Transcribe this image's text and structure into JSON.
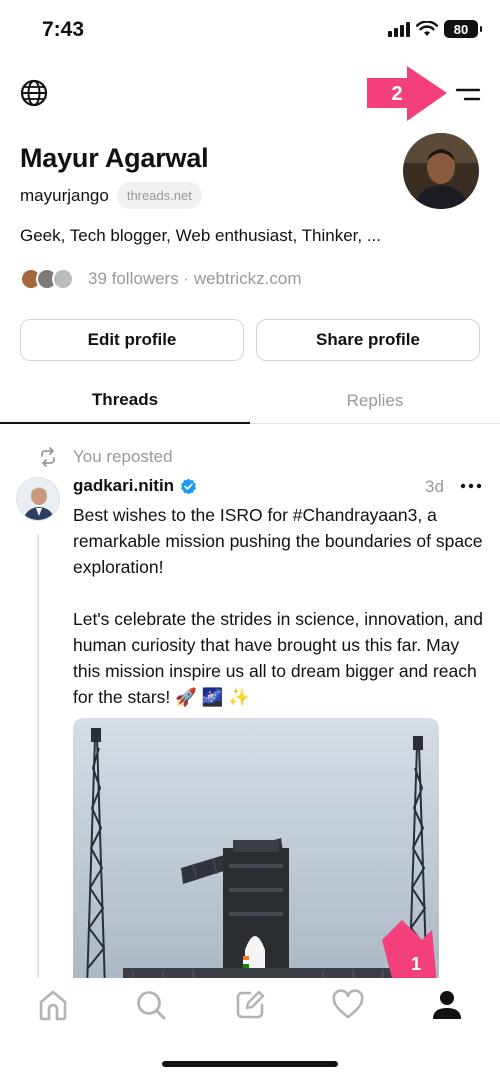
{
  "status": {
    "time": "7:43",
    "battery": "80"
  },
  "header": {
    "globe_icon": "globe-icon",
    "menu_icon": "menu-icon"
  },
  "annotations": {
    "arrow_top_label": "2",
    "arrow_bottom_label": "1",
    "arrow_color": "#f4407a"
  },
  "profile": {
    "name": "Mayur Agarwal",
    "username": "mayurjango",
    "domain_chip": "threads.net",
    "bio": "Geek, Tech blogger, Web enthusiast, Thinker, ...",
    "followers_text": "39 followers · webtrickz.com"
  },
  "buttons": {
    "edit": "Edit profile",
    "share": "Share profile"
  },
  "tabs": [
    {
      "label": "Threads",
      "active": true
    },
    {
      "label": "Replies",
      "active": false
    }
  ],
  "post": {
    "repost_label": "You reposted",
    "author": "gadkari.nitin",
    "time": "3d",
    "paragraph1": "Best wishes to the ISRO for #Chandrayaan3, a remarkable mission pushing the boundaries of space exploration!",
    "paragraph2": "Let's celebrate the strides in science, innovation, and human curiosity that have brought us this far. May this mission inspire us all to dream bigger and reach for the stars! 🚀 🌌 ✨"
  },
  "tab_bar": {
    "items": [
      "home-icon",
      "search-icon",
      "compose-icon",
      "heart-icon",
      "profile-icon"
    ],
    "active": "profile-icon"
  }
}
